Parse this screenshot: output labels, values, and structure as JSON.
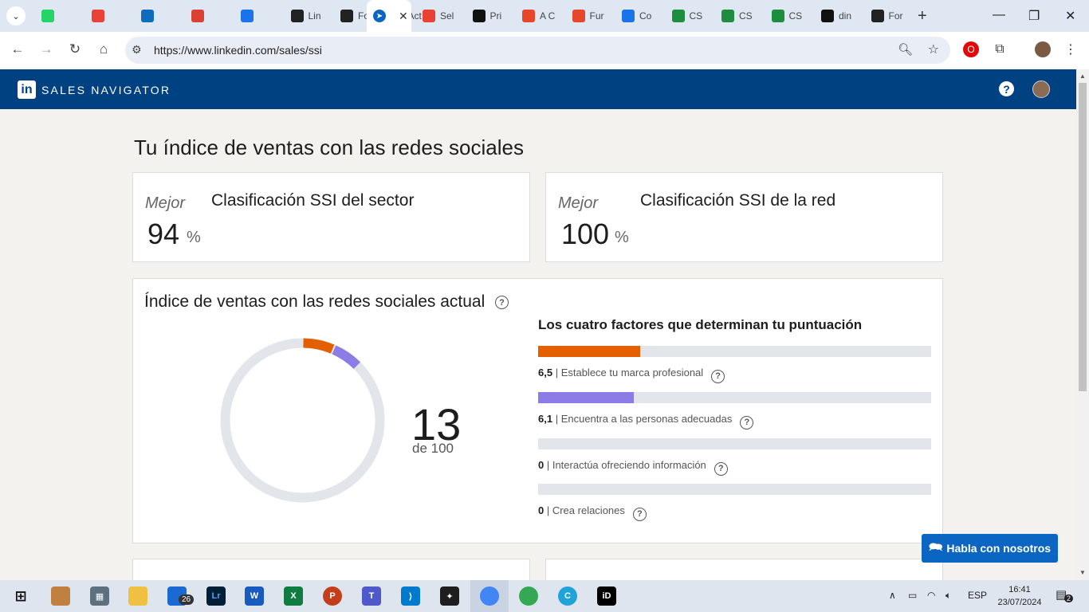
{
  "browser": {
    "tabs": [
      {
        "label": "",
        "icon": "whatsapp-icon",
        "color": "#25d366"
      },
      {
        "label": "",
        "icon": "gmail-icon",
        "color": "#ea4335"
      },
      {
        "label": "",
        "icon": "outlook-icon",
        "color": "#0f6cbd"
      },
      {
        "label": "",
        "icon": "todoist-icon",
        "color": "#db4035"
      },
      {
        "label": "",
        "icon": "c-icon",
        "color": "#1a73e8"
      },
      {
        "label": "Lin",
        "icon": "a-icon",
        "color": "#222222"
      },
      {
        "label": "For",
        "icon": "a-icon",
        "color": "#222222"
      },
      {
        "label": "Act",
        "icon": "linkedin-icon",
        "color": "#0a66c2"
      }
    ],
    "active_tab": {
      "label": "",
      "icon": "compass-icon",
      "color": "#0a66c2"
    },
    "tabs_right": [
      {
        "label": "Sel",
        "icon": "colorful-icon",
        "color": "#e94235"
      },
      {
        "label": "Pri",
        "icon": "m-icon",
        "color": "#111111"
      },
      {
        "label": "A C",
        "icon": "asterisk-icon",
        "color": "#e8462a"
      },
      {
        "label": "Fur",
        "icon": "asterisk-icon",
        "color": "#e8462a"
      },
      {
        "label": "Co",
        "icon": "c-icon",
        "color": "#1a73e8"
      },
      {
        "label": "CS",
        "icon": "w-icon",
        "color": "#1e8e3e"
      },
      {
        "label": "CS",
        "icon": "w-icon",
        "color": "#1e8e3e"
      },
      {
        "label": "CS",
        "icon": "w-icon",
        "color": "#1e8e3e"
      },
      {
        "label": "din",
        "icon": "m-icon",
        "color": "#111111"
      },
      {
        "label": "For",
        "icon": "a-icon",
        "color": "#222222"
      }
    ],
    "url": "https://www.linkedin.com/sales/ssi"
  },
  "header": {
    "logo": "in",
    "title": "SALES NAVIGATOR"
  },
  "page": {
    "title": "Tu índice de ventas con las redes sociales",
    "industry": {
      "label": "Mejor",
      "value": "94",
      "unit": "%",
      "title": "Clasificación SSI del sector"
    },
    "network": {
      "label": "Mejor",
      "value": "100",
      "unit": "%",
      "title": "Clasificación SSI de la red"
    },
    "ssi": {
      "title": "Índice de ventas con las redes sociales actual",
      "score": "13",
      "score_of": "de 100",
      "factors_title": "Los cuatro factores que determinan tu puntuación",
      "factors": [
        {
          "value": "6,5",
          "label": "Establece tu marca profesional",
          "fraction": 0.26,
          "color": "#e35f00"
        },
        {
          "value": "6,1",
          "label": "Encuentra a las personas adecuadas",
          "fraction": 0.244,
          "color": "#8c7ce6"
        },
        {
          "value": "0",
          "label": "Interactúa ofreciendo información",
          "fraction": 0,
          "color": "#2e9bd6"
        },
        {
          "value": "0",
          "label": "Crea relaciones",
          "fraction": 0,
          "color": "#2fa86e"
        }
      ]
    },
    "chat_button": "Habla con nosotros"
  },
  "taskbar": {
    "badge": "26",
    "language": "ESP",
    "time": "16:41",
    "date": "23/07/2024",
    "notifications": "2"
  }
}
